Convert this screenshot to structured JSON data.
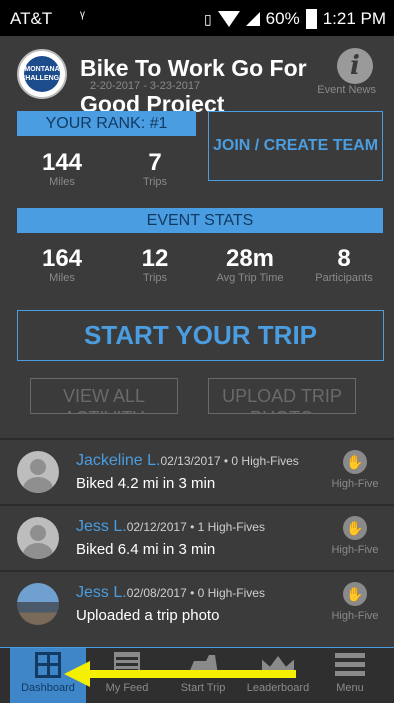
{
  "status_bar": {
    "carrier": "AT&T",
    "battery": "60%",
    "time": "1:21 PM"
  },
  "header": {
    "logo_text": "MONTANA CHALLENGE",
    "title": "Bike To Work Go For Good Project",
    "dates": "2-20-2017 - 3-23-2017",
    "info_icon": "i",
    "event_news": "Event News"
  },
  "rank": {
    "label": "YOUR RANK: #1",
    "miles_value": "144",
    "miles_label": "Miles",
    "trips_value": "7",
    "trips_label": "Trips"
  },
  "join_button": "JOIN / CREATE TEAM",
  "event_stats": {
    "label": "EVENT STATS",
    "miles_value": "164",
    "miles_label": "Miles",
    "trips_value": "12",
    "trips_label": "Trips",
    "avg_value": "28m",
    "avg_label": "Avg Trip Time",
    "participants_value": "8",
    "participants_label": "Participants"
  },
  "start_trip_button": "START YOUR TRIP",
  "view_all_button": "VIEW ALL ACTIVITY",
  "upload_button": "UPLOAD TRIP PHOTO",
  "feed": [
    {
      "name": "Jackeline L.",
      "meta": "02/13/2017 • 0 High-Fives",
      "text": "Biked 4.2 mi in 3 min",
      "high_five": "High-Five"
    },
    {
      "name": "Jess L.",
      "meta": "02/12/2017 • 1 High-Fives",
      "text": "Biked 6.4 mi in 3 min",
      "high_five": "High-Five"
    },
    {
      "name": "Jess L.",
      "meta": "02/08/2017 • 0 High-Fives",
      "text": "Uploaded a trip photo",
      "high_five": "High-Five"
    }
  ],
  "tabs": [
    {
      "label": "Dashboard",
      "icon": "dashboard-icon"
    },
    {
      "label": "My Feed",
      "icon": "feed-icon"
    },
    {
      "label": "Start Trip",
      "icon": "bike-icon"
    },
    {
      "label": "Leaderboard",
      "icon": "crown-icon"
    },
    {
      "label": "Menu",
      "icon": "menu-icon"
    }
  ],
  "colors": {
    "accent": "#4a9de0",
    "background": "#3b3b3b",
    "annotation_arrow": "#f5f000"
  }
}
